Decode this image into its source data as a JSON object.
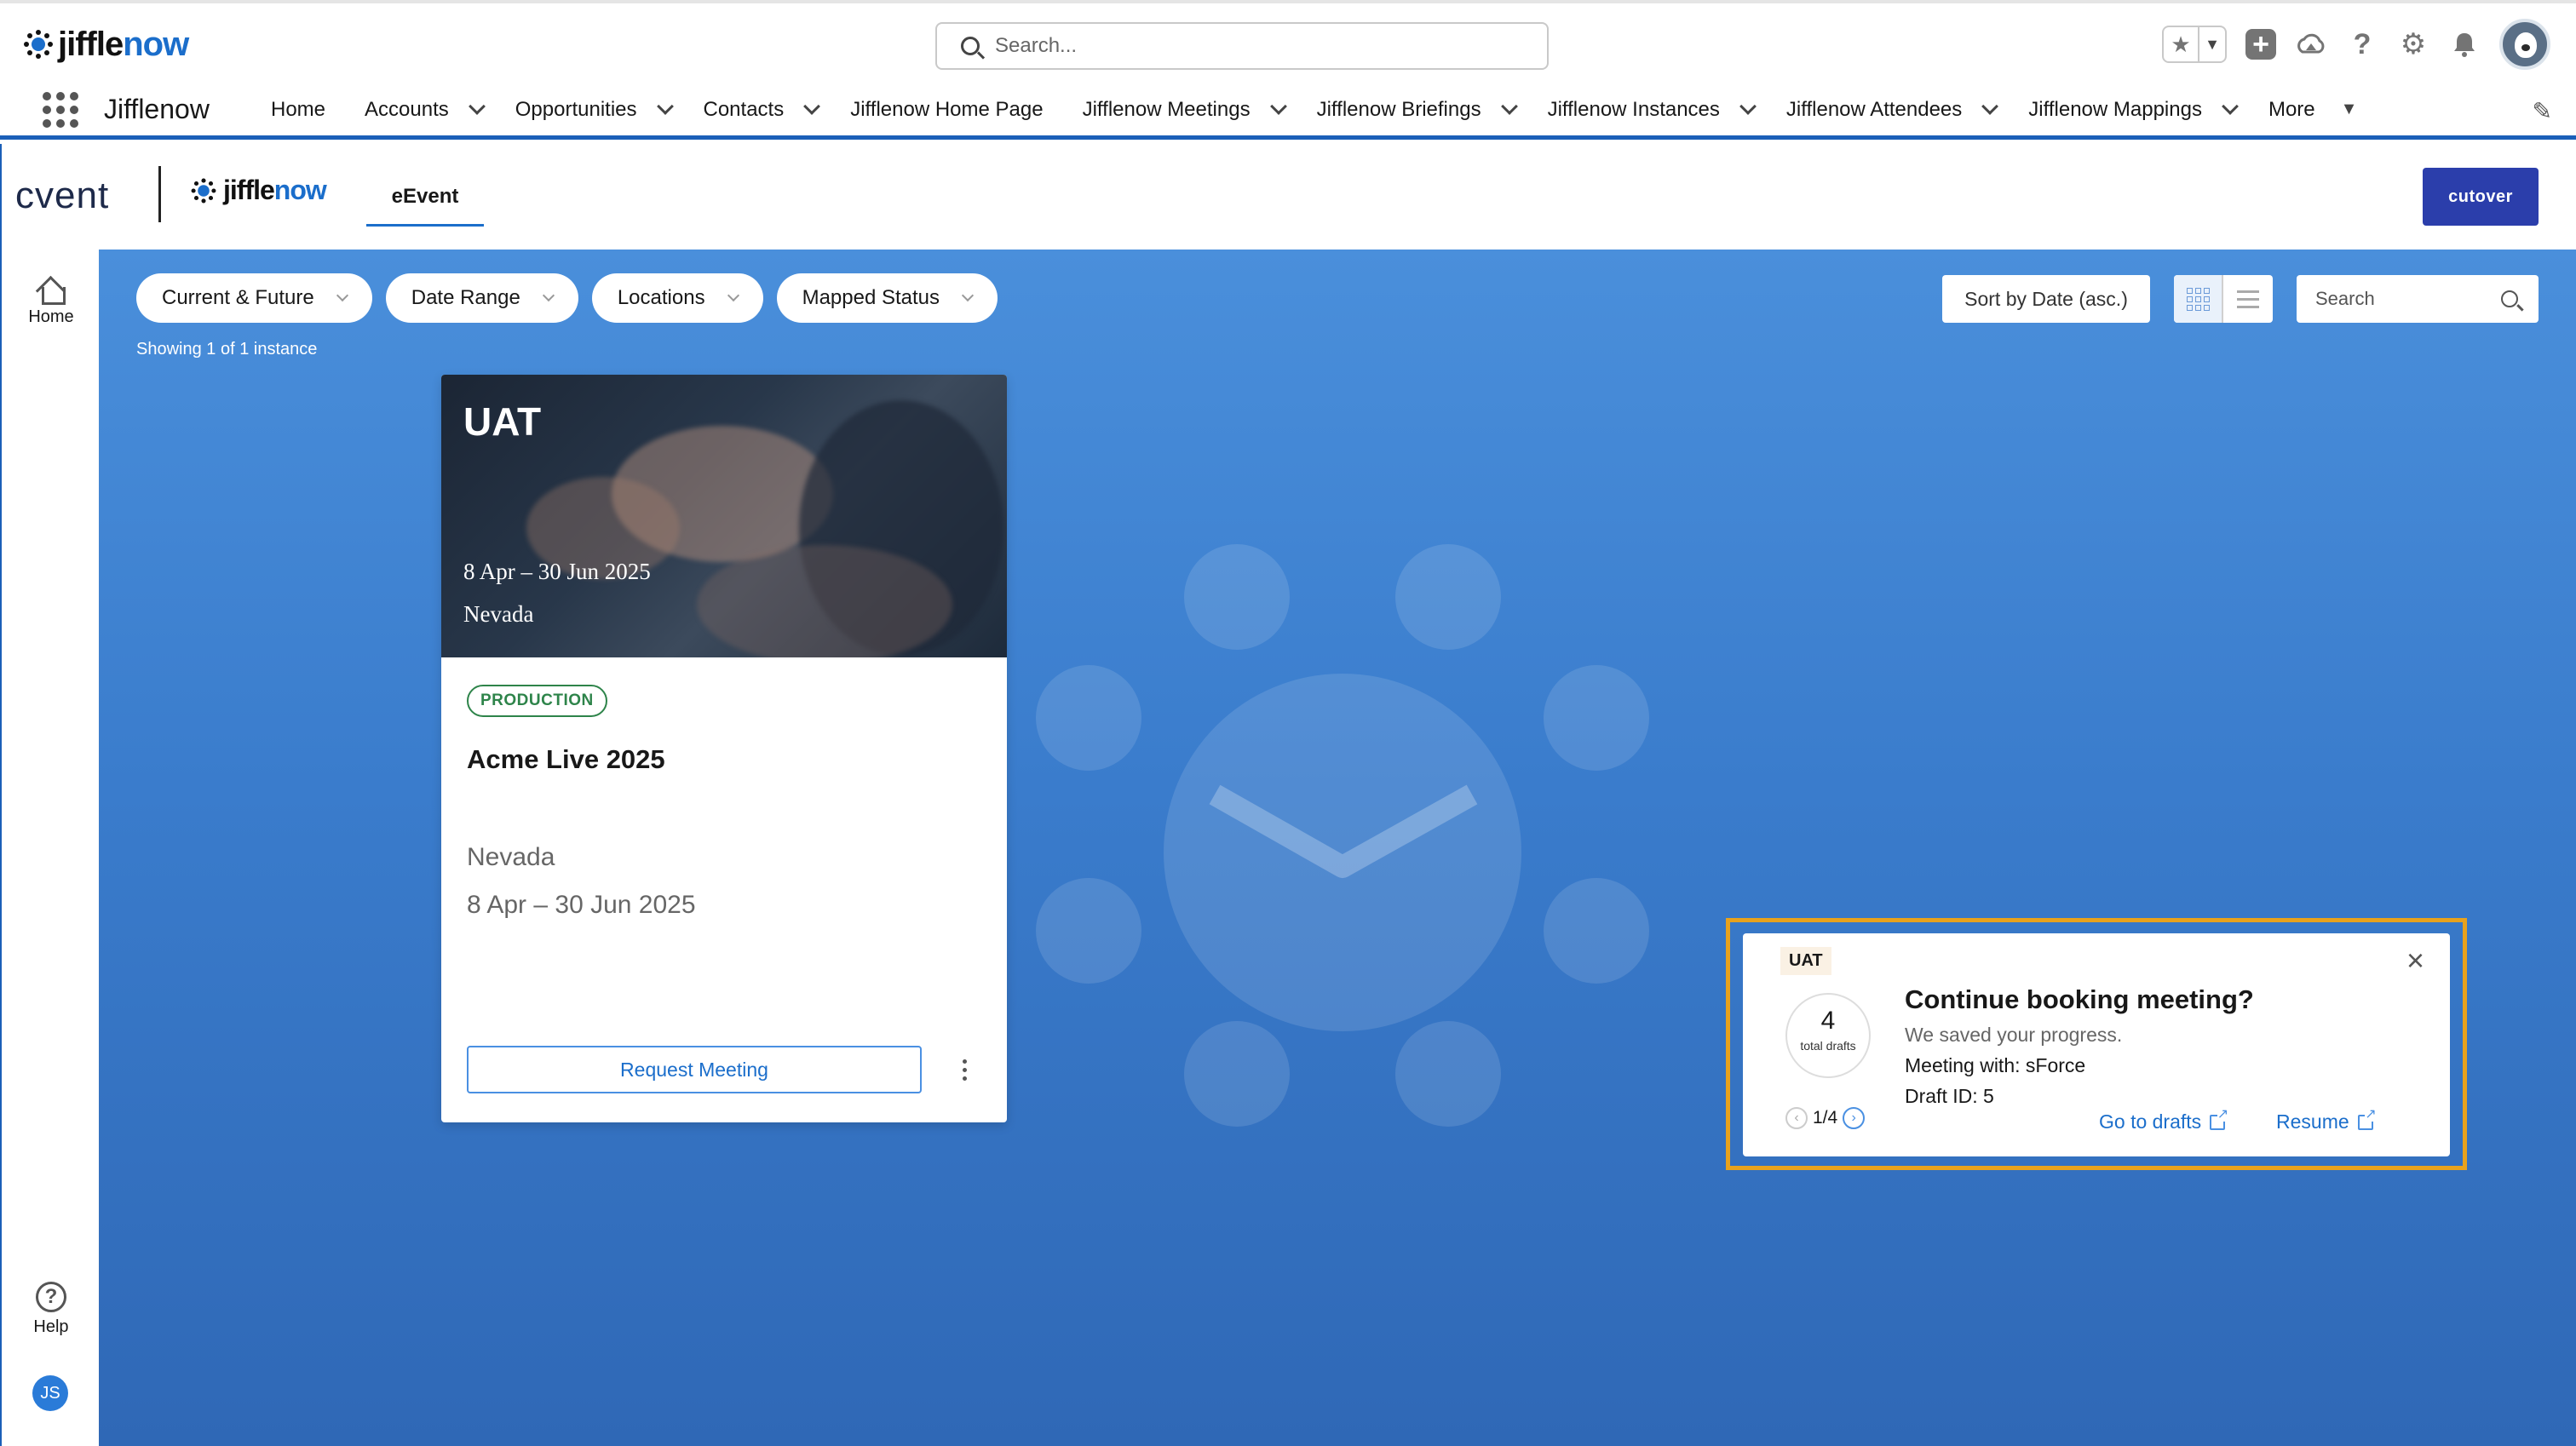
{
  "header": {
    "logo_text_main": "jiffle",
    "logo_text_accent": "now",
    "search_placeholder": "Search...",
    "icons": [
      "star-icon",
      "chevron-down-icon",
      "plus-icon",
      "trailhead-icon",
      "help-icon",
      "gear-icon",
      "bell-icon",
      "avatar"
    ]
  },
  "nav": {
    "app_name": "Jifflenow",
    "items": [
      {
        "label": "Home",
        "dropdown": false
      },
      {
        "label": "Accounts",
        "dropdown": true
      },
      {
        "label": "Opportunities",
        "dropdown": true
      },
      {
        "label": "Contacts",
        "dropdown": true
      },
      {
        "label": "Jifflenow Home Page",
        "dropdown": false
      },
      {
        "label": "Jifflenow Meetings",
        "dropdown": true
      },
      {
        "label": "Jifflenow Briefings",
        "dropdown": true
      },
      {
        "label": "Jifflenow Instances",
        "dropdown": true
      },
      {
        "label": "Jifflenow Attendees",
        "dropdown": true
      },
      {
        "label": "Jifflenow Mappings",
        "dropdown": true
      },
      {
        "label": "More",
        "dropdown": true
      }
    ]
  },
  "cvent_bar": {
    "cvent_logo": "cvent",
    "tab_label": "eEvent",
    "cutover_label": "cutover"
  },
  "rail": {
    "home_label": "Home",
    "help_label": "Help",
    "user_initials": "JS"
  },
  "filters": {
    "pills": [
      "Current & Future",
      "Date Range",
      "Locations",
      "Mapped Status"
    ],
    "showing_text": "Showing 1 of 1 instance",
    "sort_label": "Sort by Date (asc.)",
    "search_placeholder": "Search"
  },
  "event_card": {
    "env": "UAT",
    "hero_date": "8 Apr – 30 Jun 2025",
    "hero_location": "Nevada",
    "badge": "PRODUCTION",
    "title": "Acme Live 2025",
    "location": "Nevada",
    "date": "8 Apr – 30 Jun 2025",
    "request_label": "Request Meeting"
  },
  "draft_panel": {
    "env_tag": "UAT",
    "count": "4",
    "count_label": "total drafts",
    "pager": "1/4",
    "title": "Continue booking meeting?",
    "subtitle": "We saved your progress.",
    "meeting_with": "Meeting with: sForce",
    "draft_id": "Draft ID: 5",
    "go_to_drafts": "Go to drafts",
    "resume": "Resume"
  },
  "colors": {
    "brand_blue": "#1b6ecb",
    "main_bg": "#3a7ccc",
    "cutover_bg": "#2b3eab",
    "production_green": "#2e844a",
    "highlight_outline": "#e8a21d"
  }
}
